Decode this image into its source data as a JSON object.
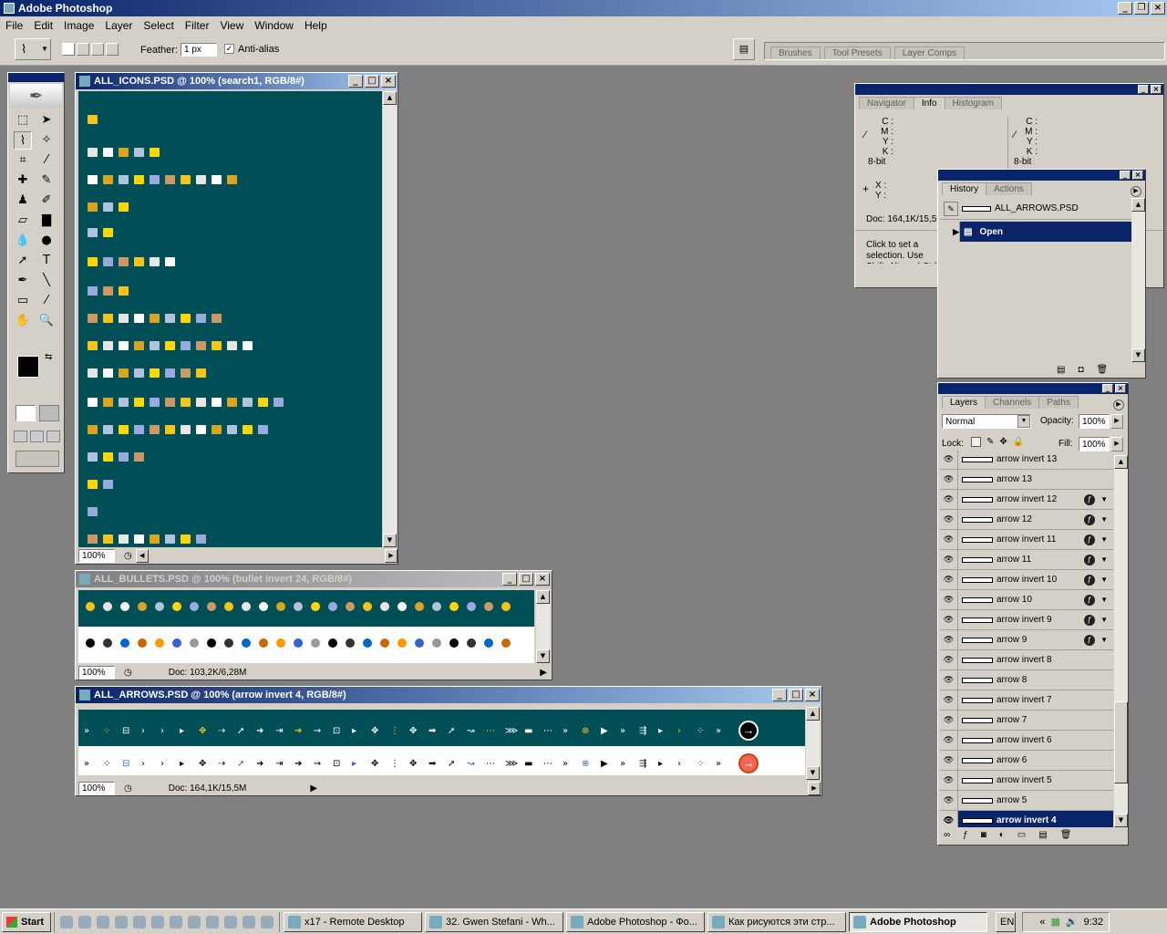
{
  "app": {
    "title": "Adobe Photoshop"
  },
  "menu": [
    "File",
    "Edit",
    "Image",
    "Layer",
    "Select",
    "Filter",
    "View",
    "Window",
    "Help"
  ],
  "options": {
    "feather_label": "Feather:",
    "feather_value": "1 px",
    "antialias_label": "Anti-alias",
    "antialias_checked": true
  },
  "palette_well": {
    "tabs": [
      "Brushes",
      "Tool Presets",
      "Layer Comps"
    ]
  },
  "docs": [
    {
      "title": "ALL_ICONS.PSD @ 100% (search1, RGB/8#)",
      "zoom": "100%"
    },
    {
      "title": "ALL_BULLETS.PSD @ 100% (bullet invert 24, RGB/8#)",
      "zoom": "100%",
      "doc_info": "Doc: 103,2K/6,28M"
    },
    {
      "title": "ALL_ARROWS.PSD @ 100% (arrow  invert 4, RGB/8#)",
      "zoom": "100%",
      "doc_info": "Doc: 164,1K/15,5M"
    }
  ],
  "info_panel": {
    "tabs": [
      "Navigator",
      "Info",
      "Histogram"
    ],
    "active_tab": "Info",
    "cmyk_labels": [
      "C :",
      "M :",
      "Y :",
      "K :"
    ],
    "bit_depth": "8-bit",
    "xy_labels": [
      "X :",
      "Y :"
    ],
    "doc_info": "Doc: 164,1K/15,5M",
    "hint": "Click to set a selection. Use Shift, Alt, and Ctrl for additional options."
  },
  "history_panel": {
    "tabs": [
      "History",
      "Actions"
    ],
    "active_tab": "History",
    "snapshot": "ALL_ARROWS.PSD",
    "states": [
      "Open"
    ]
  },
  "layers_panel": {
    "tabs": [
      "Layers",
      "Channels",
      "Paths"
    ],
    "active_tab": "Layers",
    "blend_mode": "Normal",
    "opacity_label": "Opacity:",
    "opacity": "100%",
    "lock_label": "Lock:",
    "fill_label": "Fill:",
    "fill": "100%",
    "layers": [
      {
        "name": "arrow  invert 13",
        "fx": false
      },
      {
        "name": "arrow 13",
        "fx": false
      },
      {
        "name": "arrow  invert 12",
        "fx": true
      },
      {
        "name": "arrow 12",
        "fx": true
      },
      {
        "name": "arrow  invert 11",
        "fx": true
      },
      {
        "name": "arrow 11",
        "fx": true
      },
      {
        "name": "arrow  invert 10",
        "fx": true
      },
      {
        "name": "arrow 10",
        "fx": true
      },
      {
        "name": "arrow  invert 9",
        "fx": true
      },
      {
        "name": "arrow 9",
        "fx": true
      },
      {
        "name": "arrow  invert 8",
        "fx": false
      },
      {
        "name": "arrow 8",
        "fx": false
      },
      {
        "name": "arrow  invert 7",
        "fx": false
      },
      {
        "name": "arrow 7",
        "fx": false
      },
      {
        "name": "arrow  invert 6",
        "fx": false
      },
      {
        "name": "arrow 6",
        "fx": false
      },
      {
        "name": "arrow  invert 5",
        "fx": false
      },
      {
        "name": "arrow 5",
        "fx": false
      },
      {
        "name": "arrow  invert 4",
        "fx": false,
        "selected": true
      }
    ]
  },
  "taskbar": {
    "start": "Start",
    "tasks": [
      {
        "label": "x17 - Remote Desktop"
      },
      {
        "label": "32. Gwen Stefani - Wh..."
      },
      {
        "label": "Adobe Photoshop - Фо..."
      },
      {
        "label": "Как рисуются эти стр..."
      },
      {
        "label": "Adobe Photoshop",
        "active": true
      }
    ],
    "lang": "EN",
    "clock": "9:32"
  },
  "colors": {
    "titlebar": "#0a246a",
    "canvas": "#004e56",
    "face": "#d4d0c8"
  }
}
